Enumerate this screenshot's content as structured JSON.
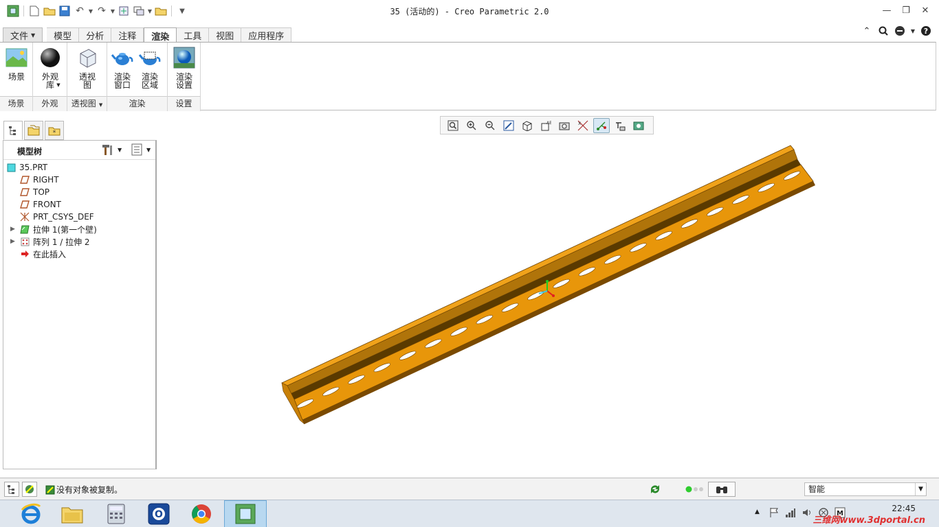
{
  "window": {
    "title": "35 (活动的) - Creo Parametric 2.0"
  },
  "tabs": [
    {
      "label": "文件",
      "name": "tab-file"
    },
    {
      "label": "模型",
      "name": "tab-model"
    },
    {
      "label": "分析",
      "name": "tab-analysis"
    },
    {
      "label": "注释",
      "name": "tab-annotate"
    },
    {
      "label": "渲染",
      "name": "tab-render"
    },
    {
      "label": "工具",
      "name": "tab-tools"
    },
    {
      "label": "视图",
      "name": "tab-view"
    },
    {
      "label": "应用程序",
      "name": "tab-applications"
    }
  ],
  "ribbon": {
    "scene": {
      "label": "场景",
      "group": "场景"
    },
    "appearance": {
      "label": "外观\n库",
      "group": "外观"
    },
    "perspective": {
      "label": "透视\n图",
      "group": "透视图"
    },
    "render_window": {
      "label": "渲染\n窗口"
    },
    "render_region": {
      "label": "渲染\n区域"
    },
    "render_group": "渲染",
    "render_settings": {
      "label": "渲染\n设置",
      "group": "设置"
    }
  },
  "model_tree": {
    "title": "模型树",
    "items": [
      {
        "label": "35.PRT",
        "icon": "part-icon",
        "expandable": false,
        "level": 0
      },
      {
        "label": "RIGHT",
        "icon": "datum-plane-icon",
        "expandable": false,
        "level": 1
      },
      {
        "label": "TOP",
        "icon": "datum-plane-icon",
        "expandable": false,
        "level": 1
      },
      {
        "label": "FRONT",
        "icon": "datum-plane-icon",
        "expandable": false,
        "level": 1
      },
      {
        "label": "PRT_CSYS_DEF",
        "icon": "csys-icon",
        "expandable": false,
        "level": 1
      },
      {
        "label": "拉伸 1(第一个壁)",
        "icon": "extrude-icon",
        "expandable": true,
        "level": 1
      },
      {
        "label": "阵列 1 / 拉伸 2",
        "icon": "pattern-icon",
        "expandable": true,
        "level": 1
      },
      {
        "label": "在此插入",
        "icon": "insert-here-icon",
        "expandable": false,
        "level": 1
      }
    ]
  },
  "status": {
    "message": "没有对象被复制。",
    "filter_value": "智能"
  },
  "taskbar": {
    "time": "22:45",
    "watermark": "三维网www.3dportal.cn"
  },
  "colors": {
    "part": "#E8960A",
    "part_dark": "#9A5A00",
    "accent": "#1E73BE"
  }
}
